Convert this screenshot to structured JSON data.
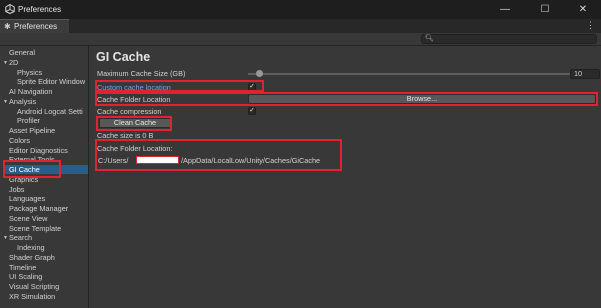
{
  "window": {
    "title": "Preferences",
    "icon": "unity-logo-icon",
    "minimize_glyph": "—",
    "maximize_glyph": "☐",
    "close_glyph": "✕"
  },
  "tab": {
    "label": "Preferences",
    "icon": "gear-icon",
    "icon_glyph": "✱",
    "menu_glyph": "⋮"
  },
  "search": {
    "placeholder": "",
    "icon_glyph": "🔍︎"
  },
  "sidebar": {
    "items": [
      {
        "label": "General",
        "indent": 0
      },
      {
        "label": "2D",
        "indent": 0,
        "expanded": true
      },
      {
        "label": "Physics",
        "indent": 1
      },
      {
        "label": "Sprite Editor Window",
        "indent": 1
      },
      {
        "label": "AI Navigation",
        "indent": 0
      },
      {
        "label": "Analysis",
        "indent": 0,
        "expanded": true
      },
      {
        "label": "Android Logcat Setti",
        "indent": 1
      },
      {
        "label": "Profiler",
        "indent": 1
      },
      {
        "label": "Asset Pipeline",
        "indent": 0
      },
      {
        "label": "Colors",
        "indent": 0
      },
      {
        "label": "Editor Diagnostics",
        "indent": 0
      },
      {
        "label": "External Tools",
        "indent": 0
      },
      {
        "label": "GI Cache",
        "indent": 0,
        "selected": true
      },
      {
        "label": "Graphics",
        "indent": 0
      },
      {
        "label": "Jobs",
        "indent": 0
      },
      {
        "label": "Languages",
        "indent": 0
      },
      {
        "label": "Package Manager",
        "indent": 0
      },
      {
        "label": "Scene View",
        "indent": 0
      },
      {
        "label": "Scene Template",
        "indent": 0
      },
      {
        "label": "Search",
        "indent": 0,
        "expanded": true
      },
      {
        "label": "Indexing",
        "indent": 1
      },
      {
        "label": "Shader Graph",
        "indent": 0
      },
      {
        "label": "Timeline",
        "indent": 0
      },
      {
        "label": "UI Scaling",
        "indent": 0
      },
      {
        "label": "Visual Scripting",
        "indent": 0
      },
      {
        "label": "XR Simulation",
        "indent": 0
      }
    ]
  },
  "main": {
    "heading": "GI Cache",
    "max_cache_label": "Maximum Cache Size (GB)",
    "max_cache_value": "10",
    "custom_location_label": "Custom cache location",
    "custom_location_checked": "✓",
    "folder_location_label": "Cache Folder Location",
    "browse_label": "Browse...",
    "compression_label": "Cache compression",
    "compression_checked": "✓",
    "clean_label": "Clean Cache",
    "cache_size_text": "Cache size is 0 B",
    "folder_location_header": "Cache Folder Location:",
    "path_prefix": "C:/Users/",
    "path_suffix": "/AppData/LocalLow/Unity/Caches/GiCache"
  },
  "colors": {
    "accent_highlight": "#e0242f",
    "selection": "#2c5d87",
    "link_blue": "#6ea7e8",
    "background": "#383838"
  }
}
